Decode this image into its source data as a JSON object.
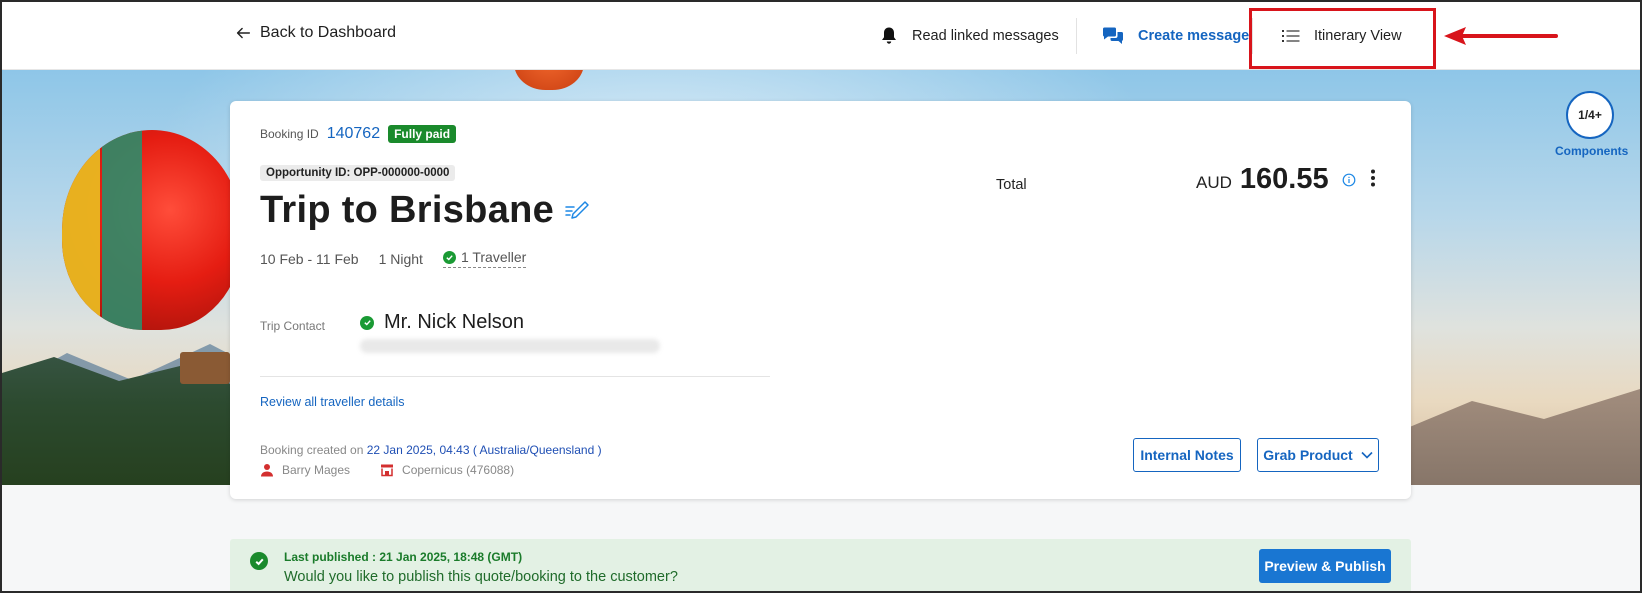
{
  "header": {
    "back_label": "Back to Dashboard",
    "read_messages_label": "Read linked messages",
    "create_message_label": "Create message",
    "itinerary_view_label": "Itinerary View"
  },
  "booking": {
    "id_label": "Booking ID",
    "id": "140762",
    "payment_status": "Fully paid",
    "opportunity": "Opportunity ID: OPP-000000-0000",
    "title": "Trip to Brisbane",
    "dates": "10 Feb - 11 Feb",
    "nights": "1 Night",
    "travellers": "1 Traveller",
    "contact_label": "Trip Contact",
    "contact_name": "Mr. Nick Nelson",
    "review_link": "Review all traveller details",
    "created_prefix": "Booking created on",
    "created_value": "22 Jan 2025, 04:43 ( Australia/Queensland )",
    "agent_name": "Barry Mages",
    "company": "Copernicus (476088)"
  },
  "total": {
    "label": "Total",
    "currency": "AUD",
    "amount": "160.55"
  },
  "actions": {
    "internal_notes": "Internal Notes",
    "grab_product": "Grab Product"
  },
  "components": {
    "count": "1/4+",
    "label": "Components"
  },
  "publish_banner": {
    "title": "Last published : 21 Jan 2025, 18:48 (GMT)",
    "message": "Would you like to publish this quote/booking to the customer?",
    "button": "Preview & Publish"
  },
  "colors": {
    "accent": "#1565c0",
    "success": "#1a8a2c",
    "highlight": "#d8141b"
  }
}
